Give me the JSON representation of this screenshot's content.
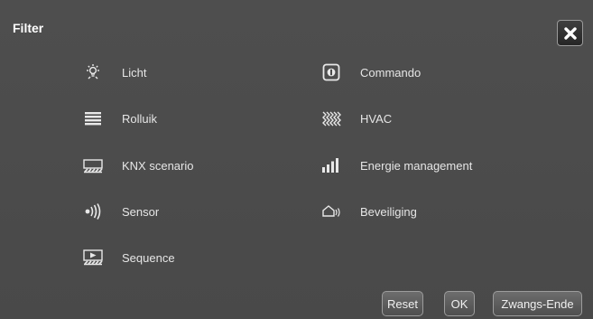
{
  "dialog": {
    "title": "Filter",
    "close_icon": "close-icon"
  },
  "filters": {
    "left": [
      {
        "label": "Licht",
        "icon": "light-bulb-icon"
      },
      {
        "label": "Rolluik",
        "icon": "rolluik-icon"
      },
      {
        "label": "KNX scenario",
        "icon": "scenario-icon"
      },
      {
        "label": "Sensor",
        "icon": "sensor-icon"
      },
      {
        "label": "Sequence",
        "icon": "sequence-icon"
      }
    ],
    "right": [
      {
        "label": "Commando",
        "icon": "command-icon"
      },
      {
        "label": "HVAC",
        "icon": "hvac-icon"
      },
      {
        "label": "Energie management",
        "icon": "energy-bars-icon"
      },
      {
        "label": "Beveiliging",
        "icon": "security-icon"
      }
    ]
  },
  "buttons": {
    "reset": "Reset",
    "ok": "OK",
    "force_end": "Zwangs-Ende"
  }
}
